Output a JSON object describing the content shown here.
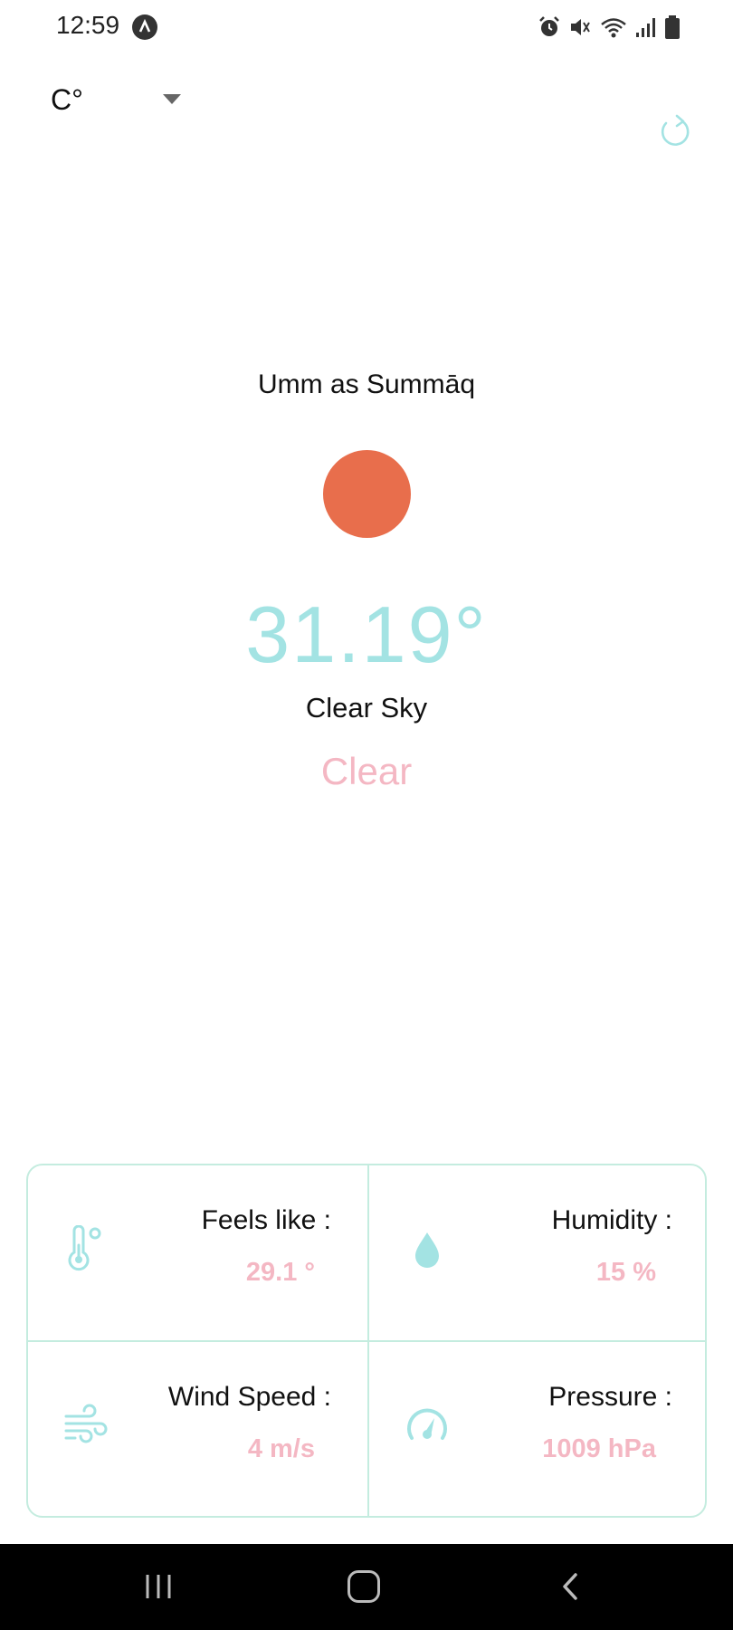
{
  "status_bar": {
    "time": "12:59",
    "icons": [
      "app-notification-icon",
      "alarm-icon",
      "mute-icon",
      "wifi-icon",
      "signal-icon",
      "battery-icon"
    ]
  },
  "unit_selector": {
    "selected": "C°"
  },
  "weather": {
    "city": "Umm as Summāq",
    "temperature": "31.19°",
    "description": "Clear Sky",
    "condition": "Clear",
    "icon_color": "#e86e4c"
  },
  "stats": {
    "feels_like": {
      "label": "Feels like :",
      "value": "29.1 °"
    },
    "humidity": {
      "label": "Humidity :",
      "value": "15 %"
    },
    "wind_speed": {
      "label": "Wind Speed :",
      "value": "4 m/s"
    },
    "pressure": {
      "label": "Pressure :",
      "value": "1009 hPa"
    }
  },
  "colors": {
    "accent_teal": "#a3e3e3",
    "accent_pink": "#f4b7c3",
    "card_border": "#c4ecdf"
  }
}
